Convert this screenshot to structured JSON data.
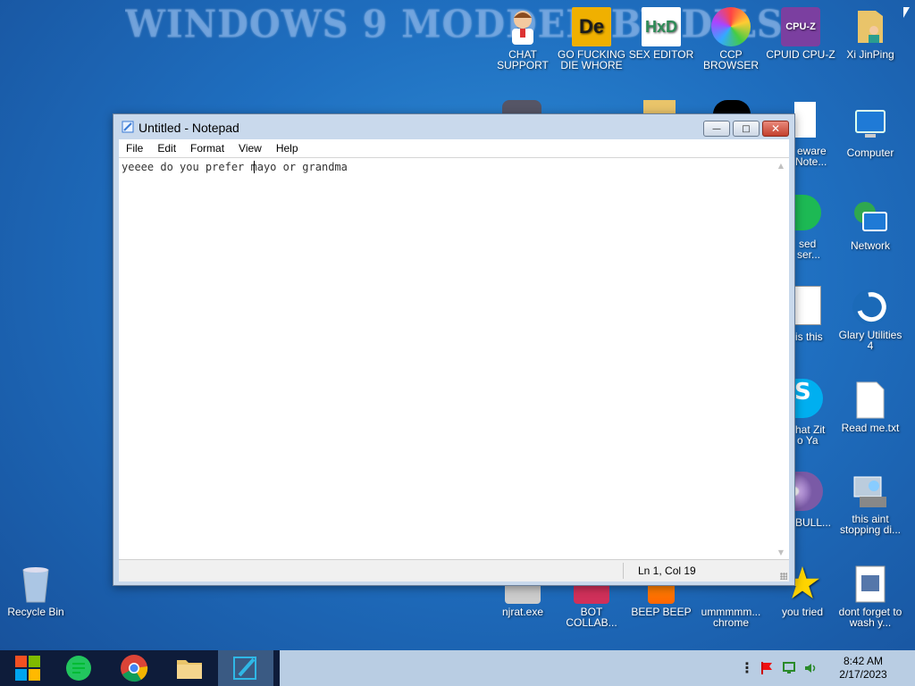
{
  "desktop": {
    "banner": "WINDOWS 9 MODDED BY DILSHAD S... WA... S",
    "icons": [
      {
        "label": "CHAT SUPPORT"
      },
      {
        "label": "GO FUCKING DIE WHORE"
      },
      {
        "label": "SEX EDITOR"
      },
      {
        "label": "CCP BROWSER"
      },
      {
        "label": "CPUID CPU-Z"
      },
      {
        "label": "Xi JinPing"
      },
      {
        "label": "Computer"
      },
      {
        "label": "Network"
      },
      {
        "label": "Glary Utilities 4"
      },
      {
        "label": "Read me.txt"
      },
      {
        "label": "this aint stopping di..."
      },
      {
        "label": "dont forget to wash y..."
      },
      {
        "label": "you tried"
      },
      {
        "label": "ummmmm... chrome"
      },
      {
        "label": "BEEP BEEP"
      },
      {
        "label": "BOT COLLAB..."
      },
      {
        "label": "njrat.exe"
      },
      {
        "label": "Recycle Bin"
      }
    ],
    "partial_labels": [
      "eware",
      "Note...",
      "sed",
      "ser...",
      "is this",
      "hat Zit",
      "o Ya",
      "BULL..."
    ],
    "icon_texts": {
      "die": "De",
      "hxd": "HxD",
      "cpuz": "CPU-Z"
    }
  },
  "notepad": {
    "title": "Untitled - Notepad",
    "menu": [
      "File",
      "Edit",
      "Format",
      "View",
      "Help"
    ],
    "content": "yeeee do you prefer mayo or grandma",
    "status_position": "Ln 1, Col 19",
    "controls": {
      "minimize": "—",
      "maximize": "□",
      "close": "✕"
    }
  },
  "taskbar": {
    "time": "8:42 AM",
    "date": "2/17/2023",
    "overflow": "⋮"
  },
  "colors": {
    "accent": "#3a5a83",
    "desktop": "#1f6fc0",
    "taskbar": "#0e1c3a"
  }
}
